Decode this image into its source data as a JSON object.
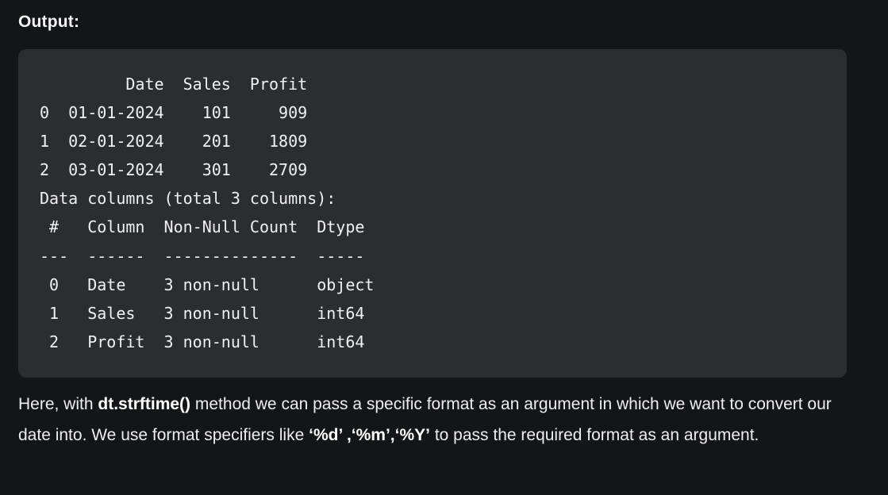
{
  "section_label": "Output:",
  "code_output": {
    "lines": [
      "         Date  Sales  Profit",
      "0  01-01-2024    101     909",
      "1  02-01-2024    201    1809",
      "2  03-01-2024    301    2709",
      "Data columns (total 3 columns):",
      " #   Column  Non-Null Count  Dtype ",
      "---  ------  --------------  ----- ",
      " 0   Date    3 non-null      object",
      " 1   Sales   3 non-null      int64 ",
      " 2   Profit  3 non-null      int64 "
    ]
  },
  "explanation": {
    "part1": "Here, with ",
    "method": "dt.strftime()",
    "part2": " method we can pass a specific format as an argument in which we want to convert our date into. We use format specifiers like ",
    "specifiers": "‘%d’ ,‘%m’,‘%Y’",
    "part3": " to pass the required format as an argument."
  },
  "colors": {
    "page_background": "#141519",
    "code_background": "#2b2d31",
    "text": "#e8e8ea"
  }
}
